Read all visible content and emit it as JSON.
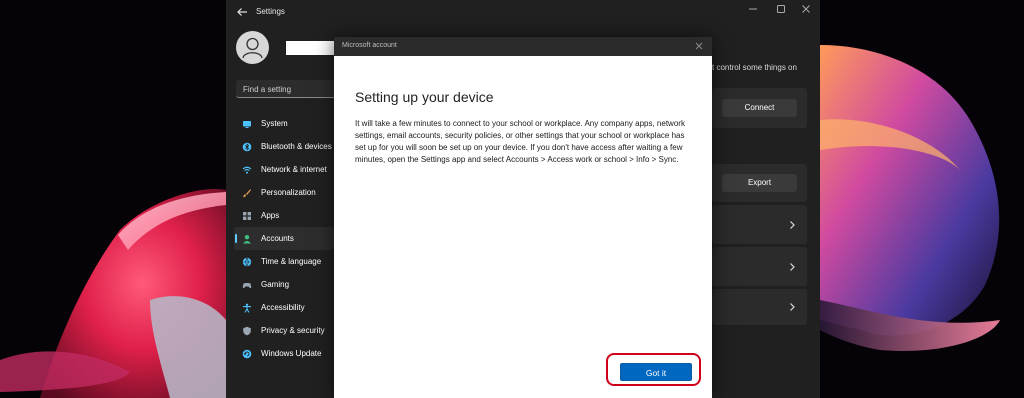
{
  "window": {
    "title": "Settings"
  },
  "search": {
    "placeholder": "Find a setting"
  },
  "sidebar": {
    "items": [
      {
        "label": "System",
        "icon": "monitor-icon",
        "color": "#4cc2ff"
      },
      {
        "label": "Bluetooth & devices",
        "icon": "bluetooth-icon",
        "color": "#4cc2ff"
      },
      {
        "label": "Network & internet",
        "icon": "wifi-icon",
        "color": "#4cc2ff"
      },
      {
        "label": "Personalization",
        "icon": "brush-icon",
        "color": "#e0a050"
      },
      {
        "label": "Apps",
        "icon": "apps-icon",
        "color": "#9aa6b2"
      },
      {
        "label": "Accounts",
        "icon": "person-icon",
        "color": "#3fbf7f"
      },
      {
        "label": "Time & language",
        "icon": "globe-icon",
        "color": "#4cc2ff"
      },
      {
        "label": "Gaming",
        "icon": "controller-icon",
        "color": "#9aa6b2"
      },
      {
        "label": "Accessibility",
        "icon": "accessibility-icon",
        "color": "#4cc2ff"
      },
      {
        "label": "Privacy & security",
        "icon": "shield-icon",
        "color": "#9aa6b2"
      },
      {
        "label": "Windows Update",
        "icon": "update-icon",
        "color": "#4cc2ff"
      }
    ],
    "active_index": 5
  },
  "main": {
    "side_text": "t control some things on",
    "connect_label": "Connect",
    "export_label": "Export"
  },
  "dialog": {
    "title": "Microsoft account",
    "heading": "Setting up your device",
    "body": "It will take a few minutes to connect to your school or workplace. Any company apps, network settings, email accounts, security policies, or other settings that your school or workplace has set up for you will soon be set up on your device. If you don't have access after waiting a few minutes, open the Settings app and select Accounts > Access work or school > Info > Sync.",
    "button_label": "Got it"
  },
  "colors": {
    "accent": "#0067c0",
    "highlight": "#d0021b"
  }
}
